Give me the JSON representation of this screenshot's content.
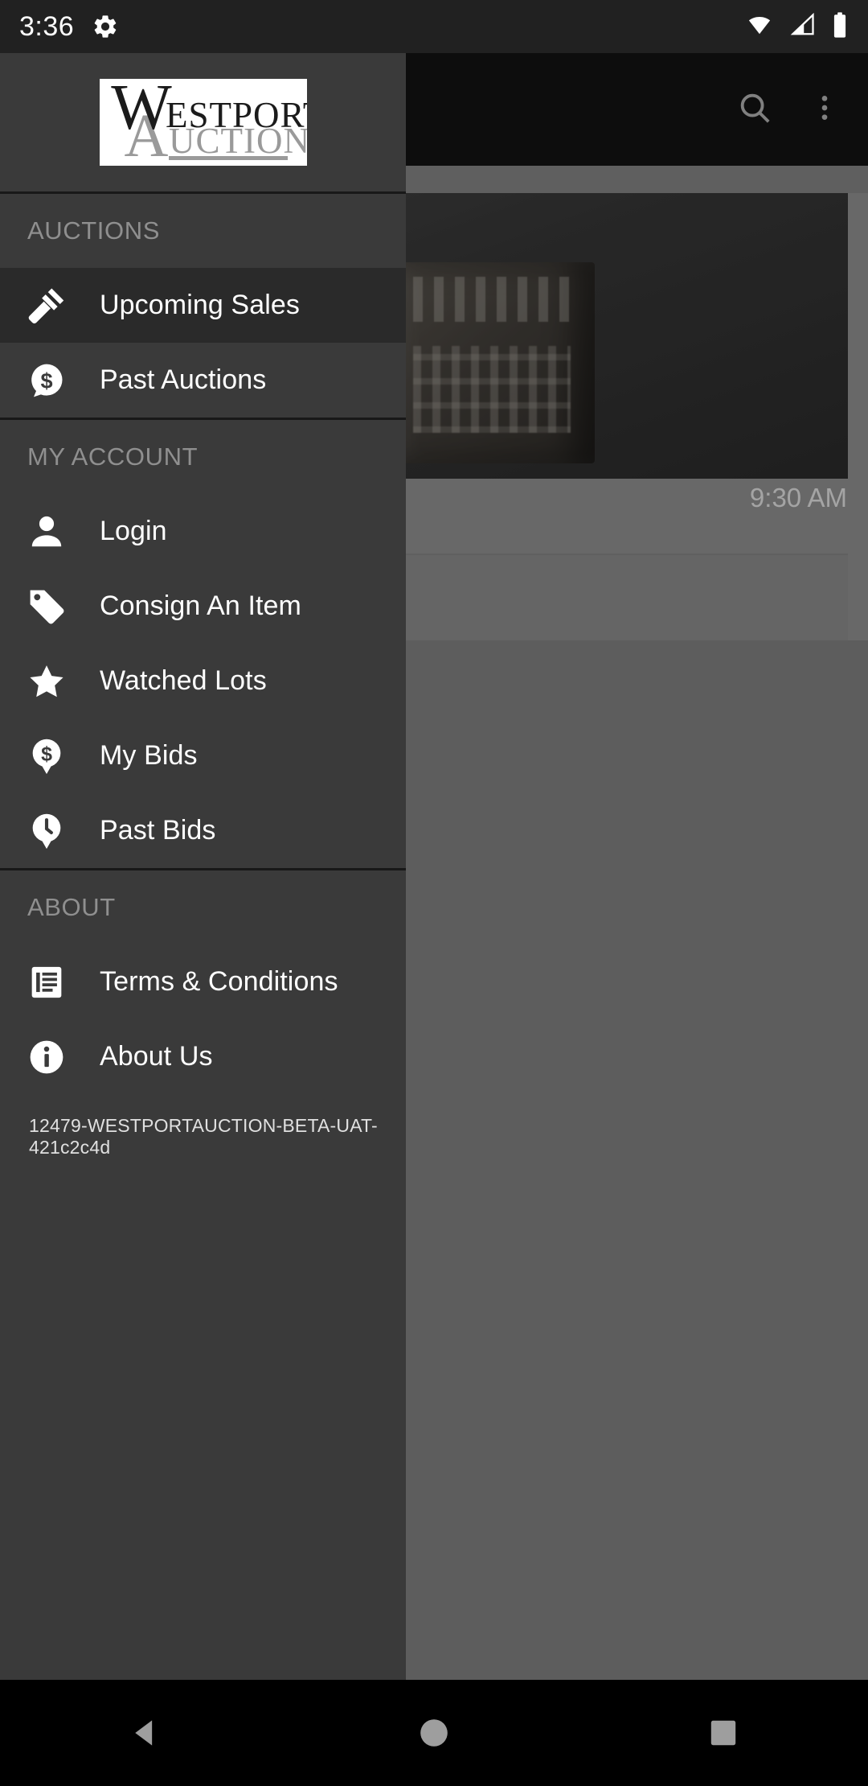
{
  "status_bar": {
    "time": "3:36",
    "icons": [
      "gear-icon",
      "wifi-icon",
      "cellular-signal-icon",
      "battery-icon"
    ]
  },
  "app_bar": {
    "search_icon": "search-icon",
    "overflow_icon": "more-vertical-icon"
  },
  "background_content": {
    "listing_time": "9:30 AM"
  },
  "drawer": {
    "logo": {
      "line1": "WESTPORT",
      "line2": "AUCTION",
      "alt": "Westport Auction logo"
    },
    "sections": [
      {
        "label": "AUCTIONS",
        "items": [
          {
            "label": "Upcoming Sales",
            "icon": "gavel-icon",
            "selected": true
          },
          {
            "label": "Past Auctions",
            "icon": "dollar-speech-bubble-icon",
            "selected": false
          }
        ]
      },
      {
        "label": "MY ACCOUNT",
        "items": [
          {
            "label": "Login",
            "icon": "person-icon",
            "selected": false
          },
          {
            "label": "Consign An Item",
            "icon": "tag-icon",
            "selected": false
          },
          {
            "label": "Watched Lots",
            "icon": "star-icon",
            "selected": false
          },
          {
            "label": "My Bids",
            "icon": "dollar-pin-icon",
            "selected": false
          },
          {
            "label": "Past Bids",
            "icon": "clock-pin-icon",
            "selected": false
          }
        ]
      },
      {
        "label": "ABOUT",
        "items": [
          {
            "label": "Terms & Conditions",
            "icon": "document-lines-icon",
            "selected": false
          },
          {
            "label": "About Us",
            "icon": "info-circle-icon",
            "selected": false
          }
        ]
      }
    ],
    "version": "12479-WESTPORTAUCTION-BETA-UAT-421c2c4d"
  },
  "system_nav": {
    "back": "back-triangle-icon",
    "home": "home-circle-icon",
    "recents": "recents-square-icon"
  },
  "colors": {
    "drawer_bg": "#3a3a3a",
    "drawer_selected": "#2a2a2a",
    "status_bar_bg": "#212121",
    "app_bar_bg": "#141414",
    "section_label": "#8f8f8f",
    "item_label": "#ffffff",
    "nav_bar_bg": "#000000"
  }
}
